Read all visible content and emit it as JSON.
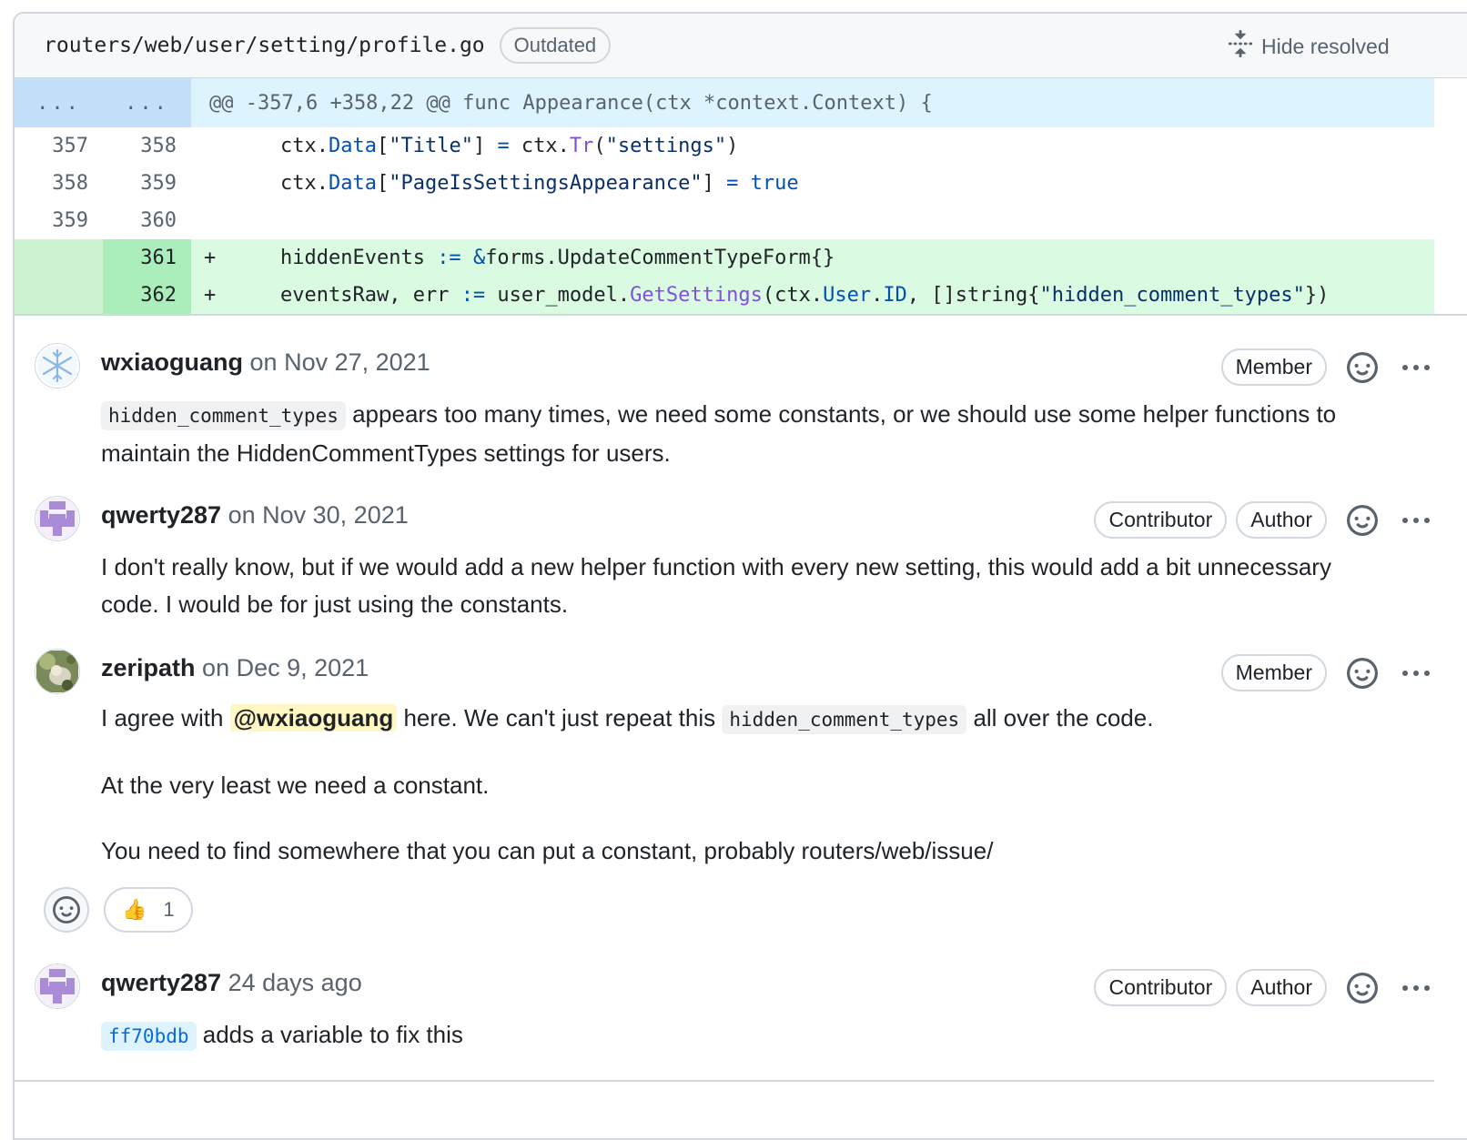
{
  "file_header": {
    "path": "routers/web/user/setting/profile.go",
    "status_badge": "Outdated",
    "hide_resolved_label": "Hide resolved"
  },
  "diff": {
    "hunk": {
      "old_dots": "...",
      "new_dots": "...",
      "header": "@@ -357,6 +358,22 @@ func Appearance(ctx *context.Context) {"
    },
    "lines": [
      {
        "old": "357",
        "new": "358",
        "marker": "",
        "type": "context"
      },
      {
        "old": "358",
        "new": "359",
        "marker": "",
        "type": "context"
      },
      {
        "old": "359",
        "new": "360",
        "marker": "",
        "type": "context"
      },
      {
        "old": "",
        "new": "361",
        "marker": "+",
        "type": "add"
      },
      {
        "old": "",
        "new": "362",
        "marker": "+",
        "type": "add"
      }
    ],
    "code": {
      "l1": {
        "a": "ctx.",
        "b": "Data",
        "c": "[",
        "d": "\"Title\"",
        "e": "] ",
        "f": "=",
        "g": " ctx.",
        "h": "Tr",
        "i": "(",
        "j": "\"settings\"",
        "k": ")"
      },
      "l2": {
        "a": "ctx.",
        "b": "Data",
        "c": "[",
        "d": "\"PageIsSettingsAppearance\"",
        "e": "] ",
        "f": "=",
        "g": " ",
        "h": "true"
      },
      "l4": {
        "a": "hiddenEvents ",
        "b": ":=",
        "c": " ",
        "d": "&",
        "e": "forms.UpdateCommentTypeForm{}"
      },
      "l5": {
        "a": "eventsRaw, err ",
        "b": ":=",
        "c": " user_model.",
        "d": "GetSettings",
        "e": "(ctx.",
        "f": "User",
        "g": ".",
        "h": "ID",
        "i": ", []string{",
        "j": "\"hidden_comment_types\"",
        "k": "})"
      }
    }
  },
  "comments": [
    {
      "author": "wxiaoguang",
      "date": "on Nov 27, 2021",
      "badges": [
        "Member"
      ],
      "body": {
        "code": "hidden_comment_types",
        "text": " appears too many times, we need some constants, or we should use some helper functions to maintain the HiddenCommentTypes settings for users."
      }
    },
    {
      "author": "qwerty287",
      "date": "on Nov 30, 2021",
      "badges": [
        "Contributor",
        "Author"
      ],
      "body": {
        "text": "I don't really know, but if we would add a new helper function with every new setting, this would add a bit unnecessary code. I would be for just using the constants."
      }
    },
    {
      "author": "zeripath",
      "date": "on Dec 9, 2021",
      "badges": [
        "Member"
      ],
      "body": {
        "p1_a": "I agree with ",
        "mention": "@wxiaoguang",
        "p1_b": " here. We can't just repeat this ",
        "code": "hidden_comment_types",
        "p1_c": " all over the code.",
        "p2": "At the very least we need a constant.",
        "p3": "You need to find somewhere that you can put a constant, probably routers/web/issue/"
      },
      "reactions": [
        {
          "emoji": "👍",
          "count": "1"
        }
      ]
    },
    {
      "author": "qwerty287",
      "date": "24 days ago",
      "badges": [
        "Contributor",
        "Author"
      ],
      "body": {
        "sha": "ff70bdb",
        "text": " adds a variable to fix this"
      }
    }
  ],
  "colors": {
    "hunk_bg": "#ddf4ff",
    "hunk_num_bg": "#c3e0fb",
    "add_bg": "#dafbe1",
    "add_num_bg": "#aceebb",
    "mention_bg": "#fff8c5",
    "link": "#0969da"
  },
  "icons": {
    "hide_resolved": "fold-icon",
    "reaction": "smiley-icon",
    "more": "kebab-horizontal-icon"
  }
}
